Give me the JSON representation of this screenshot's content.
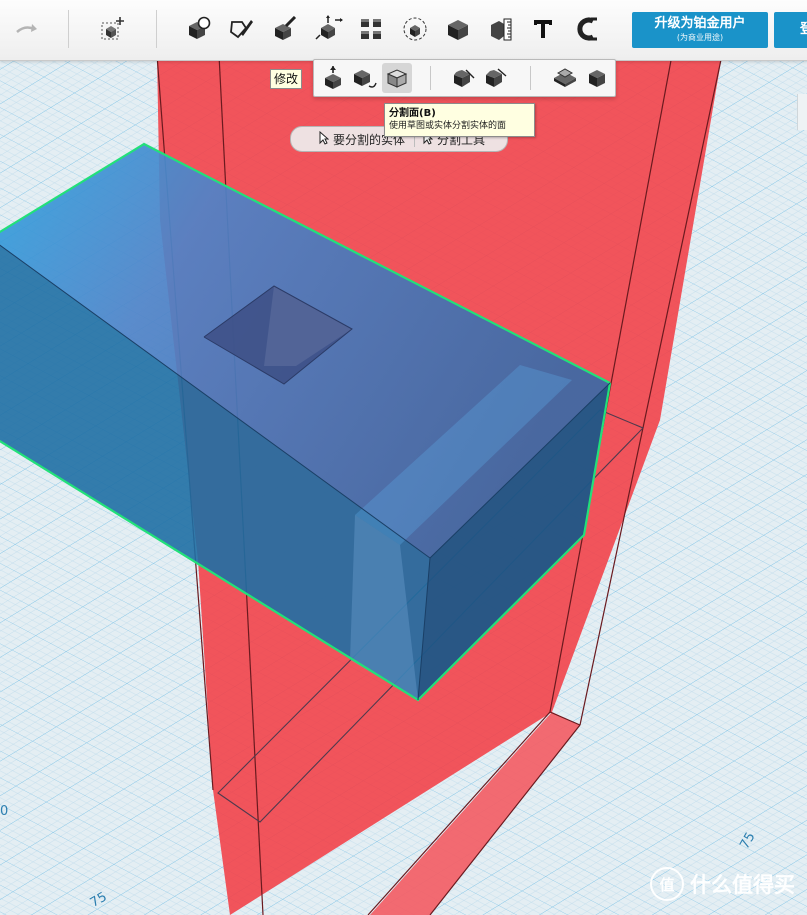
{
  "toolbar": {
    "icons": [
      "redo-icon",
      "smart-select-icon",
      "primitives-icon",
      "sketch-icon",
      "construct-icon",
      "transform-icon",
      "pattern-icon",
      "grouping-icon",
      "combine-icon",
      "measure-icon",
      "text-icon",
      "snap-icon"
    ],
    "upgrade_main": "升级为铂金用户",
    "upgrade_sub": "(为商业用途)",
    "login_label": "登"
  },
  "modify_tooltip": "修改",
  "submenu": {
    "icons": [
      "press-pull-icon",
      "tweak-icon",
      "split-face-icon",
      "fillet-icon",
      "chamfer-icon",
      "split-solid-icon",
      "shell-icon"
    ]
  },
  "tooltip": {
    "title": "分割面(B)",
    "desc": "使用草图或实体分割实体的面"
  },
  "pill": {
    "left_label": "要分割的实体",
    "right_label": "分割工具"
  },
  "grid_labels": [
    "75",
    "75",
    "0"
  ],
  "watermark": "什么值得买",
  "watermark_logo": "值"
}
